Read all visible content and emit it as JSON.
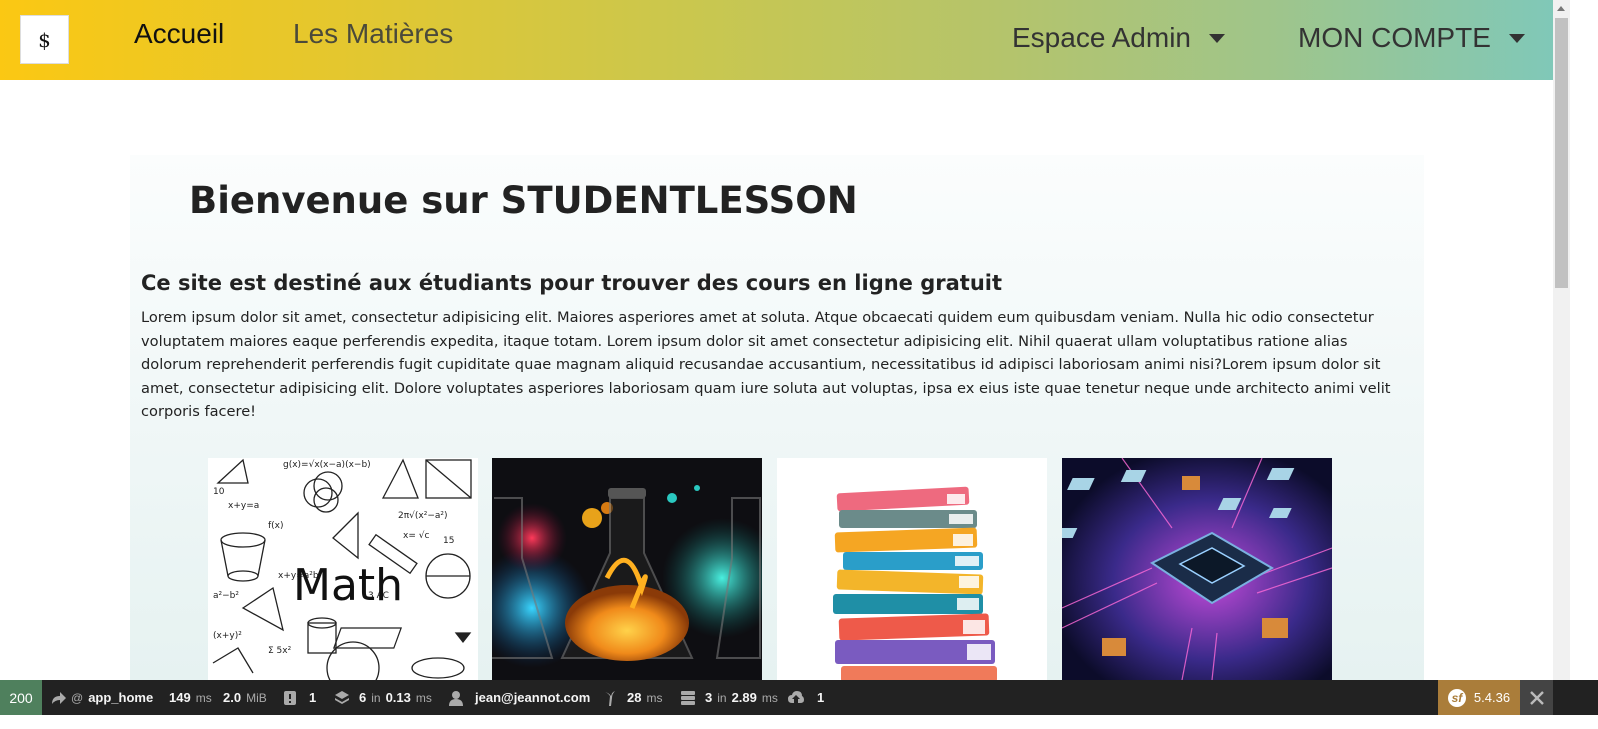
{
  "navbar": {
    "logo_text": "$",
    "home_label": "Accueil",
    "subjects_label": "Les Matières",
    "admin_label": "Espace Admin",
    "account_label": "MON COMPTE"
  },
  "main": {
    "title": "Bienvenue sur STUDENTLESSON",
    "subtitle": "Ce site est destiné aux étudiants pour trouver des cours en ligne gratuit",
    "paragraph": "Lorem ipsum dolor sit amet, consectetur adipisicing elit. Maiores asperiores amet at soluta. Atque obcaecati quidem eum quibusdam veniam. Nulla hic odio consectetur voluptatem maiores eaque perferendis expedita, itaque totam. Lorem ipsum dolor sit amet consectetur adipisicing elit. Nihil quaerat ullam voluptatibus ratione alias dolorum reprehenderit perferendis fugit cupiditate quae magnam aliquid recusandae accusantium, necessitatibus id adipisci laboriosam animi nisi?Lorem ipsum dolor sit amet, consectetur adipisicing elit. Dolore voluptates asperiores laboriosam quam iure soluta aut voluptas, ipsa ex eius iste quae tenetur neque unde architecto animi velit corporis facere!",
    "cards": [
      {
        "name": "math",
        "image_text": "Math"
      },
      {
        "name": "chemistry"
      },
      {
        "name": "books"
      },
      {
        "name": "technology"
      }
    ]
  },
  "toolbar": {
    "status_code": "200",
    "route_prefix": "@",
    "route": "app_home",
    "time_value": "149",
    "time_unit": "ms",
    "memory_value": "2.0",
    "memory_unit": "MiB",
    "logs_count": "1",
    "cache_count": "6",
    "cache_in": "in",
    "cache_time": "0.13",
    "cache_unit": "ms",
    "user": "jean@jeannot.com",
    "twig_time": "28",
    "twig_unit": "ms",
    "db_count": "3",
    "db_in": "in",
    "db_time": "2.89",
    "db_unit": "ms",
    "upload_count": "1",
    "version": "5.4.36",
    "icons": [
      "route-arrow-icon",
      "logs-icon",
      "cache-layers-icon",
      "user-icon",
      "twig-icon",
      "database-icon",
      "upload-icon",
      "symfony-logo",
      "close-icon"
    ]
  }
}
